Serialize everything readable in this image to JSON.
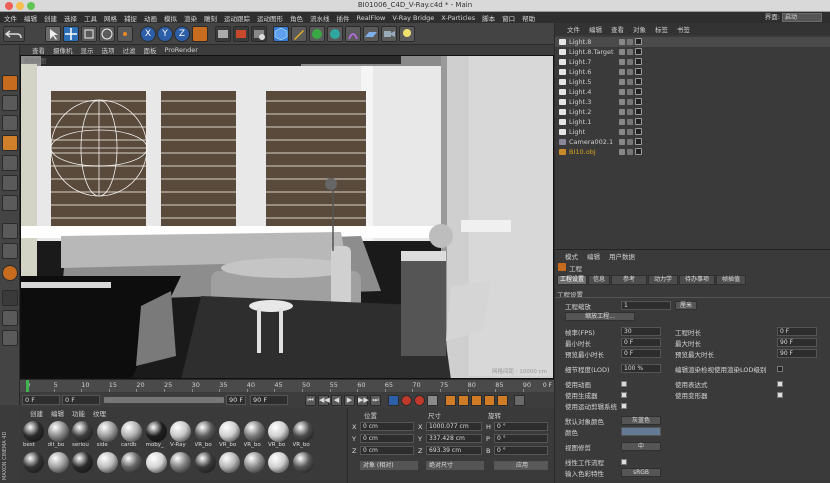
{
  "window": {
    "title": "BI01006_C4D_V-Ray.c4d * - Main"
  },
  "menu": [
    "文件",
    "编辑",
    "创建",
    "选择",
    "工具",
    "网格",
    "捕捉",
    "动画",
    "模拟",
    "渲染",
    "雕刻",
    "运动跟踪",
    "运动图形",
    "角色",
    "流水线",
    "插件",
    "RealFlow",
    "V-Ray Bridge",
    "X-Particles",
    "脚本",
    "窗口",
    "帮助"
  ],
  "layout": {
    "label": "界面:",
    "value": "启动"
  },
  "viewport": {
    "menu": [
      "查看",
      "摄像机",
      "显示",
      "选项",
      "过滤",
      "面板",
      "ProRender"
    ],
    "corner_label": "透视视图",
    "camera_label": "网格间距 : 10000 cm"
  },
  "timeline": {
    "ticks": [
      "0",
      "5",
      "10",
      "15",
      "20",
      "25",
      "30",
      "35",
      "40",
      "45",
      "50",
      "55",
      "60",
      "65",
      "70",
      "75",
      "80",
      "85",
      "90"
    ],
    "frame": "0 F"
  },
  "playback": {
    "start": "0 F",
    "current": "0 F",
    "end": "90 F",
    "end2": "90 F",
    "buttons": [
      "⏮",
      "◀◀",
      "◀",
      "▶",
      "▶▶",
      "⏭"
    ]
  },
  "materials": {
    "menu": [
      "创建",
      "编辑",
      "功能",
      "纹理"
    ],
    "items": [
      {
        "label": "best",
        "color": "#2a2a2a"
      },
      {
        "label": "dit_bo",
        "color": "#8a8a8a"
      },
      {
        "label": "seriou",
        "color": "#3d3d3d"
      },
      {
        "label": "side",
        "color": "#9a9a9a"
      },
      {
        "label": "cardb",
        "color": "#b0b0b0"
      },
      {
        "label": "moby_",
        "color": "#1e1e1e"
      },
      {
        "label": "V-Ray",
        "color": "#c8c8c8"
      },
      {
        "label": "VR_bo",
        "color": "#5a5a5a"
      },
      {
        "label": "VR_bo",
        "color": "#cfcfcf"
      },
      {
        "label": "VR_bo",
        "color": "#7a7a7a"
      },
      {
        "label": "VR_bo",
        "color": "#d0d0d0"
      },
      {
        "label": "VR_bo",
        "color": "#4a4a4a"
      },
      {
        "label": "",
        "color": "#333"
      },
      {
        "label": "",
        "color": "#a0a0a0"
      },
      {
        "label": "",
        "color": "#2a2a2a"
      },
      {
        "label": "",
        "color": "#bdbdbd"
      },
      {
        "label": "",
        "color": "#666"
      },
      {
        "label": "",
        "color": "#d5d5d5"
      },
      {
        "label": "",
        "color": "#808080"
      },
      {
        "label": "",
        "color": "#3a3a3a"
      },
      {
        "label": "",
        "color": "#b5b5b5"
      },
      {
        "label": "",
        "color": "#8c8c8c"
      },
      {
        "label": "",
        "color": "#cfcfcf"
      },
      {
        "label": "",
        "color": "#555"
      }
    ],
    "logo": "MAXON CINEMA 4D"
  },
  "coords": {
    "headers": [
      "位置",
      "尺寸",
      "旋转"
    ],
    "rows": [
      {
        "axis": "X",
        "pos": "0 cm",
        "size_axis": "X",
        "size": "1000.077 cm",
        "rot_axis": "H",
        "rot": "0 °"
      },
      {
        "axis": "Y",
        "pos": "0 cm",
        "size_axis": "Y",
        "size": "337.428 cm",
        "rot_axis": "P",
        "rot": "0 °"
      },
      {
        "axis": "Z",
        "pos": "0 cm",
        "size_axis": "Z",
        "size": "693.39 cm",
        "rot_axis": "B",
        "rot": "0 °"
      }
    ],
    "mode": "对象 (相对)",
    "size_mode": "绝对尺寸",
    "apply": "应用"
  },
  "objects": {
    "menu": [
      "文件",
      "编辑",
      "查看",
      "对象",
      "标签",
      "书签"
    ],
    "items": [
      {
        "name": "Light.8",
        "color": "#d0d0d0"
      },
      {
        "name": "Light.8.Target",
        "color": "#d0d0d0"
      },
      {
        "name": "Light.7",
        "color": "#d0d0d0"
      },
      {
        "name": "Light.6",
        "color": "#d0d0d0"
      },
      {
        "name": "Light.5",
        "color": "#d0d0d0"
      },
      {
        "name": "Light.4",
        "color": "#d0d0d0"
      },
      {
        "name": "Light.3",
        "color": "#d0d0d0"
      },
      {
        "name": "Light.2",
        "color": "#d0d0d0"
      },
      {
        "name": "Light.1",
        "color": "#d0d0d0"
      },
      {
        "name": "Light",
        "color": "#d0d0d0"
      },
      {
        "name": "Camera002.1",
        "color": "#d0d0d0"
      },
      {
        "name": "BI10.obj",
        "color": "#d9a520"
      }
    ]
  },
  "attributes": {
    "menu": [
      "模式",
      "编辑",
      "用户数据"
    ],
    "title": "工程",
    "tabs": [
      "工程设置",
      "信息",
      "参考",
      "动力学",
      "待办事项",
      "帧插值"
    ],
    "section": "工程设置",
    "scale_label": "工程缩放",
    "scale_value": "1",
    "scale_unit": "厘米",
    "scale_button": "缩放工程...",
    "fps_label": "帧率(FPS)",
    "fps": "30",
    "proj_len_label": "工程时长",
    "proj_len": "0 F",
    "min_label": "最小时长",
    "min": "0 F",
    "max_label": "最大时长",
    "max": "90 F",
    "pmin_label": "预览最小时长",
    "pmin": "0 F",
    "pmax_label": "预览最大时长",
    "pmax": "90 F",
    "lod_label": "细节程度(LOD)",
    "lod": "100 %",
    "lod_note": "编辑渲染检视使用渲染LOD级别",
    "anim_label": "使用动画",
    "expr_label": "使用表达式",
    "gen_label": "使用生成器",
    "deform_label": "使用变形器",
    "motion_label": "使用运动剪辑系统",
    "color_label": "默认对象颜色",
    "color_value": "灰蓝色",
    "color_sub": "颜色",
    "clip_label": "视图修剪",
    "clip_value": "中",
    "linear_label": "线性工作流程",
    "input_label": "输入色彩特性",
    "input_value": "sRGB"
  }
}
